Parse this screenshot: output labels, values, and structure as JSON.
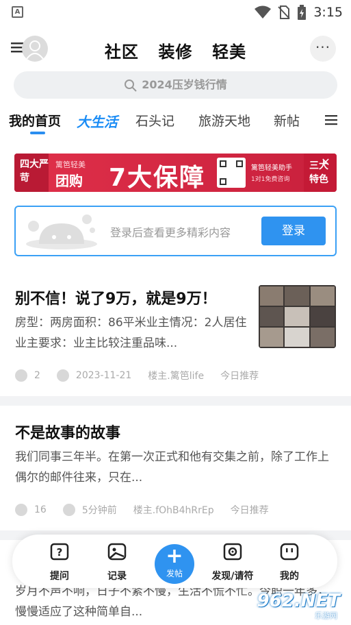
{
  "status_bar": {
    "time": "3:15",
    "app_indicator": "A"
  },
  "header": {
    "tabs": [
      "社区",
      "装修",
      "轻美"
    ],
    "more": "···"
  },
  "search": {
    "placeholder": "2024压岁钱行情"
  },
  "channels": {
    "items": [
      "我的首页",
      "大生活",
      "石头记",
      "旅游天地",
      "新帖"
    ],
    "active": "我的首页"
  },
  "banner": {
    "left_text": "四大严苛",
    "brand": "篱笆轻美",
    "tag": "团购",
    "headline": "7大保障",
    "assistant": "篱笆轻美助手",
    "assistant_sub": "1对1免费咨询",
    "right_text": "三大特色",
    "close": "✕"
  },
  "login_card": {
    "text": "登录后查看更多精彩内容",
    "button": "登录"
  },
  "feed": [
    {
      "title": "别不信！说了9万，就是9万！",
      "excerpt": "房型：两房面积：86平米业主情况：2人居住业主要求：业主比较注重品味...",
      "comments": "2",
      "date": "2023-11-21",
      "author": "楼主.篱笆life",
      "tag": "今日推荐"
    },
    {
      "title": "不是故事的故事",
      "excerpt": "我们同事三年半。在第一次正式和他有交集之前，除了工作上偶尔的邮件往来，只在...",
      "comments": "16",
      "date": "5分钟前",
      "author": "楼主.fOhB4hRrEp",
      "tag": "今日推荐"
    },
    {
      "excerpt": "岁月不声不响，日子不紧不慢，生活不慌不忙。今职一年多，慢慢适应了这种简单自..."
    }
  ],
  "bottom_nav": {
    "ask": "提问",
    "record": "记录",
    "post": "发帖",
    "discover": "发现/请符",
    "mine": "我的"
  },
  "watermark": {
    "text": "962.NET",
    "sub": "乐游网"
  },
  "colors": {
    "accent": "#2f93f0",
    "banner": "#d8283f"
  }
}
